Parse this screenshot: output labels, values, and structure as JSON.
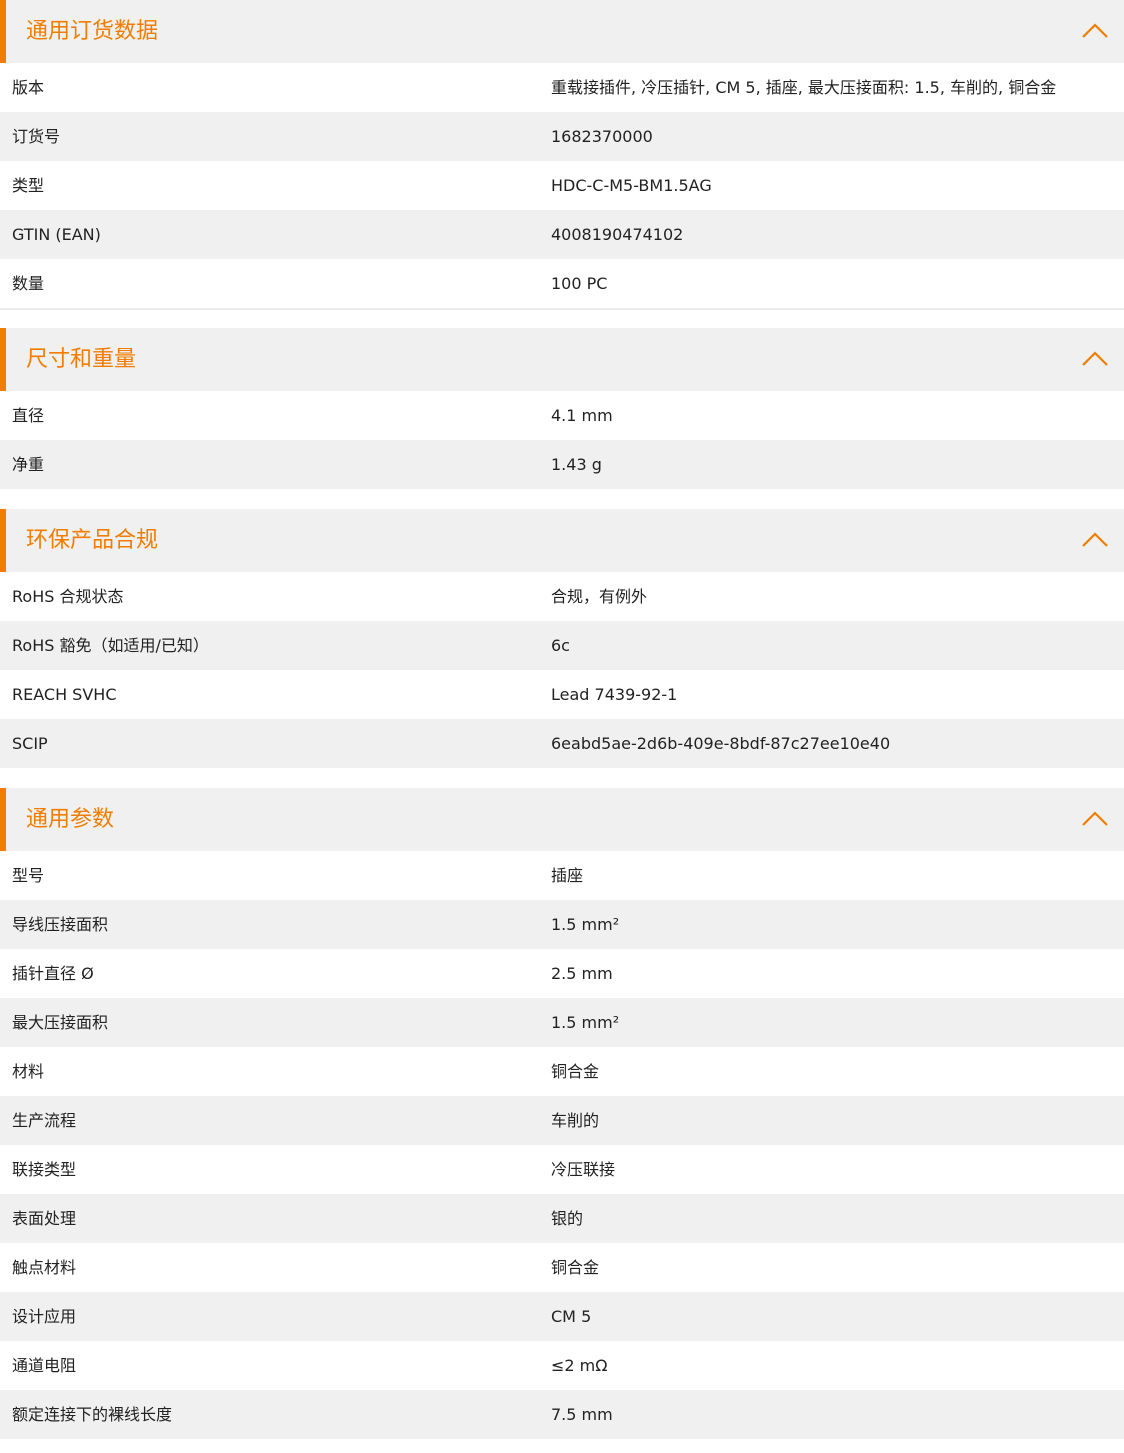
{
  "sections": [
    {
      "title": "通用订货数据",
      "rows": [
        {
          "label": "版本",
          "value": "重载接插件, 冷压插针, CM 5, 插座, 最大压接面积: 1.5, 车削的, 铜合金"
        },
        {
          "label": "订货号",
          "value": "1682370000"
        },
        {
          "label": "类型",
          "value": "HDC-C-M5-BM1.5AG"
        },
        {
          "label": "GTIN (EAN)",
          "value": "4008190474102"
        },
        {
          "label": "数量",
          "value": "100  PC"
        }
      ]
    },
    {
      "title": "尺寸和重量",
      "rows": [
        {
          "label": "直径",
          "value": "4.1  mm"
        },
        {
          "label": "净重",
          "value": "1.43  g"
        }
      ]
    },
    {
      "title": "环保产品合规",
      "rows": [
        {
          "label": "RoHS 合规状态",
          "value": "合规，有例外"
        },
        {
          "label": "RoHS 豁免（如适用/已知）",
          "value": "6c"
        },
        {
          "label": "REACH SVHC",
          "value": "Lead 7439-92-1"
        },
        {
          "label": "SCIP",
          "value": "6eabd5ae-2d6b-409e-8bdf-87c27ee10e40"
        }
      ]
    },
    {
      "title": "通用参数",
      "rows": [
        {
          "label": "型号",
          "value": "插座"
        },
        {
          "label": "导线压接面积",
          "value": "1.5 mm²"
        },
        {
          "label": "插针直径 Ø",
          "value": "2.5  mm"
        },
        {
          "label": "最大压接面积",
          "value": "1.5  mm²"
        },
        {
          "label": "材料",
          "value": "铜合金"
        },
        {
          "label": "生产流程",
          "value": "车削的"
        },
        {
          "label": "联接类型",
          "value": "冷压联接"
        },
        {
          "label": "表面处理",
          "value": "银的"
        },
        {
          "label": "触点材料",
          "value": "铜合金"
        },
        {
          "label": "设计应用",
          "value": "CM 5"
        },
        {
          "label": "通道电阻",
          "value": "≤2 mΩ"
        },
        {
          "label": "额定连接下的裸线长度",
          "value": "7.5  mm"
        }
      ]
    }
  ],
  "icons": {
    "collapse": "chevron-up-icon"
  },
  "colors": {
    "accent": "#f07d00",
    "stripe": "#f0f0f0",
    "text": "#222222"
  }
}
